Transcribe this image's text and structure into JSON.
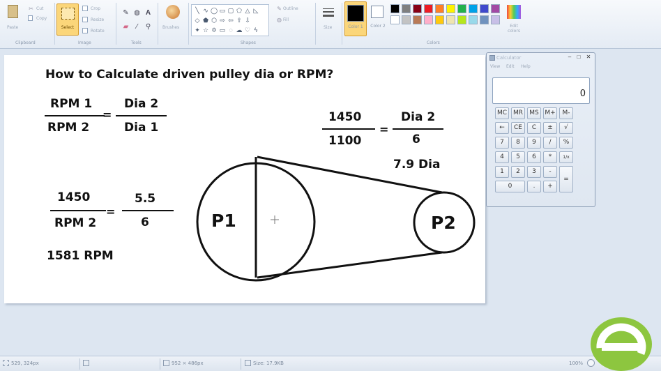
{
  "ribbon": {
    "clipboard": {
      "paste": "Paste",
      "cut": "Cut",
      "copy": "Copy",
      "caption": "Clipboard"
    },
    "image": {
      "select": "Select",
      "crop": "Crop",
      "resize": "Resize",
      "rotate": "Rotate",
      "caption": "Image"
    },
    "tools": {
      "caption": "Tools"
    },
    "brushes": "Brushes",
    "shapes": {
      "outline": "Outline",
      "fill": "Fill",
      "caption": "Shapes"
    },
    "size": "Size",
    "colors": {
      "color1": "Color 1",
      "color2": "Color 2",
      "edit": "Edit colors",
      "caption": "Colors",
      "color1_value": "#000000",
      "color2_value": "#ffffff",
      "palette_row1": [
        "#000000",
        "#7f7f7f",
        "#880015",
        "#ed1c24",
        "#ff7f27",
        "#fff200",
        "#22b14c",
        "#00a2e8",
        "#3f48cc",
        "#a349a4"
      ],
      "palette_row2": [
        "#ffffff",
        "#c3c3c3",
        "#b97a57",
        "#ffaec9",
        "#ffc90e",
        "#efe4b0",
        "#b5e61d",
        "#99d9ea",
        "#7092be",
        "#c8bfe7"
      ]
    }
  },
  "canvas": {
    "title": "How to Calculate driven pulley dia or RPM?",
    "formula": {
      "num_left": "RPM 1",
      "den_left": "RPM 2",
      "num_right": "Dia 2",
      "den_right": "Dia 1",
      "eq": "="
    },
    "example1": {
      "num_left": "1450",
      "den_left": "1100",
      "num_right": "Dia 2",
      "den_right": "6",
      "eq": "=",
      "result": "7.9 Dia"
    },
    "example2": {
      "num_left": "1450",
      "den_left": "RPM 2",
      "num_right": "5.5",
      "den_right": "6",
      "eq": "=",
      "result": "1581 RPM"
    },
    "pulley1": "P1",
    "pulley2": "P2"
  },
  "calculator": {
    "title": "Calculator",
    "menu": [
      "View",
      "Edit",
      "Help"
    ],
    "display": "0",
    "keys_row1": [
      "MC",
      "MR",
      "MS",
      "M+",
      "M-"
    ],
    "keys_row2": [
      "←",
      "CE",
      "C",
      "±",
      "√"
    ],
    "keys_row3": [
      "7",
      "8",
      "9",
      "/",
      "%"
    ],
    "keys_row4": [
      "4",
      "5",
      "6",
      "*",
      "1/x"
    ],
    "keys_row5": [
      "1",
      "2",
      "3",
      "-"
    ],
    "keys_row6": [
      "0",
      ".",
      "+"
    ],
    "key_equals": "="
  },
  "statusbar": {
    "cursor_pos": "529, 324px",
    "canvas_size": "952 × 486px",
    "file_size": "Size: 17.9KB",
    "zoom": "100%"
  }
}
